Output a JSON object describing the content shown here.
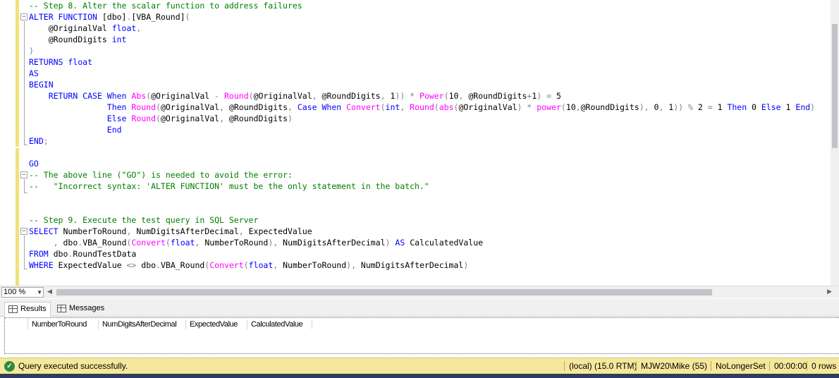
{
  "editor": {
    "lines": [
      [
        [
          "cm",
          "-- Step 8. Alter the scalar function to address failures"
        ]
      ],
      [
        [
          "kw",
          "ALTER FUNCTION "
        ],
        [
          "tx",
          "[dbo]"
        ],
        [
          "op",
          "."
        ],
        [
          "tx",
          "[VBA_Round]"
        ],
        [
          "op",
          "("
        ]
      ],
      [
        [
          "tx",
          "    @OriginalVal "
        ],
        [
          "kw",
          "float"
        ],
        [
          "op",
          ","
        ]
      ],
      [
        [
          "tx",
          "    @RoundDigits "
        ],
        [
          "kw",
          "int"
        ]
      ],
      [
        [
          "op",
          ")"
        ]
      ],
      [
        [
          "kw",
          "RETURNS float"
        ]
      ],
      [
        [
          "kw",
          "AS"
        ]
      ],
      [
        [
          "kw",
          "BEGIN"
        ]
      ],
      [
        [
          "tx",
          "    "
        ],
        [
          "kw",
          "RETURN CASE When "
        ],
        [
          "fn",
          "Abs"
        ],
        [
          "op",
          "("
        ],
        [
          "tx",
          "@OriginalVal "
        ],
        [
          "op",
          "- "
        ],
        [
          "fn",
          "Round"
        ],
        [
          "op",
          "("
        ],
        [
          "tx",
          "@OriginalVal"
        ],
        [
          "op",
          ", "
        ],
        [
          "tx",
          "@RoundDigits"
        ],
        [
          "op",
          ", "
        ],
        [
          "tx",
          "1"
        ],
        [
          "op",
          ")) * "
        ],
        [
          "fn",
          "Power"
        ],
        [
          "op",
          "("
        ],
        [
          "tx",
          "10"
        ],
        [
          "op",
          ", "
        ],
        [
          "tx",
          "@RoundDigits"
        ],
        [
          "op",
          "+"
        ],
        [
          "tx",
          "1"
        ],
        [
          "op",
          ") = "
        ],
        [
          "tx",
          "5"
        ]
      ],
      [
        [
          "tx",
          "                "
        ],
        [
          "kw",
          "Then "
        ],
        [
          "fn",
          "Round"
        ],
        [
          "op",
          "("
        ],
        [
          "tx",
          "@OriginalVal"
        ],
        [
          "op",
          ", "
        ],
        [
          "tx",
          "@RoundDigits"
        ],
        [
          "op",
          ", "
        ],
        [
          "kw",
          "Case When "
        ],
        [
          "fn",
          "Convert"
        ],
        [
          "op",
          "("
        ],
        [
          "kw",
          "int"
        ],
        [
          "op",
          ", "
        ],
        [
          "fn",
          "Round"
        ],
        [
          "op",
          "("
        ],
        [
          "fn",
          "abs"
        ],
        [
          "op",
          "("
        ],
        [
          "tx",
          "@OriginalVal"
        ],
        [
          "op",
          ") * "
        ],
        [
          "fn",
          "power"
        ],
        [
          "op",
          "("
        ],
        [
          "tx",
          "10"
        ],
        [
          "op",
          ","
        ],
        [
          "tx",
          "@RoundDigits"
        ],
        [
          "op",
          "), "
        ],
        [
          "tx",
          "0"
        ],
        [
          "op",
          ", "
        ],
        [
          "tx",
          "1"
        ],
        [
          "op",
          ")) % "
        ],
        [
          "tx",
          "2 "
        ],
        [
          "op",
          "= "
        ],
        [
          "tx",
          "1 "
        ],
        [
          "kw",
          "Then "
        ],
        [
          "tx",
          "0 "
        ],
        [
          "kw",
          "Else "
        ],
        [
          "tx",
          "1 "
        ],
        [
          "kw",
          "End"
        ],
        [
          "op",
          ")"
        ]
      ],
      [
        [
          "tx",
          "                "
        ],
        [
          "kw",
          "Else "
        ],
        [
          "fn",
          "Round"
        ],
        [
          "op",
          "("
        ],
        [
          "tx",
          "@OriginalVal"
        ],
        [
          "op",
          ", "
        ],
        [
          "tx",
          "@RoundDigits"
        ],
        [
          "op",
          ")"
        ]
      ],
      [
        [
          "tx",
          "                "
        ],
        [
          "kw",
          "End"
        ]
      ],
      [
        [
          "kw",
          "END"
        ],
        [
          "op",
          ";"
        ]
      ],
      [],
      [
        [
          "kw",
          "GO"
        ]
      ],
      [
        [
          "cm",
          "-- The above line (\"GO\") is needed to avoid the error:"
        ]
      ],
      [
        [
          "cm",
          "--   \"Incorrect syntax: 'ALTER FUNCTION' must be the only statement in the batch.\""
        ]
      ],
      [],
      [],
      [
        [
          "cm",
          "-- Step 9. Execute the test query in SQL Server"
        ]
      ],
      [
        [
          "kw",
          "SELECT "
        ],
        [
          "tx",
          "NumberToRound"
        ],
        [
          "op",
          ", "
        ],
        [
          "tx",
          "NumDigitsAfterDecimal"
        ],
        [
          "op",
          ", "
        ],
        [
          "tx",
          "ExpectedValue"
        ]
      ],
      [
        [
          "tx",
          "     "
        ],
        [
          "op",
          ", "
        ],
        [
          "tx",
          "dbo"
        ],
        [
          "op",
          "."
        ],
        [
          "tx",
          "VBA_Round"
        ],
        [
          "op",
          "("
        ],
        [
          "fn",
          "Convert"
        ],
        [
          "op",
          "("
        ],
        [
          "kw",
          "float"
        ],
        [
          "op",
          ", "
        ],
        [
          "tx",
          "NumberToRound"
        ],
        [
          "op",
          "), "
        ],
        [
          "tx",
          "NumDigitsAfterDecimal"
        ],
        [
          "op",
          ") "
        ],
        [
          "kw",
          "AS "
        ],
        [
          "tx",
          "CalculatedValue"
        ]
      ],
      [
        [
          "kw",
          "FROM "
        ],
        [
          "tx",
          "dbo"
        ],
        [
          "op",
          "."
        ],
        [
          "tx",
          "RoundTestData"
        ]
      ],
      [
        [
          "kw",
          "WHERE "
        ],
        [
          "tx",
          "ExpectedValue "
        ],
        [
          "op",
          "<> "
        ],
        [
          "tx",
          "dbo"
        ],
        [
          "op",
          "."
        ],
        [
          "tx",
          "VBA_Round"
        ],
        [
          "op",
          "("
        ],
        [
          "fn",
          "Convert"
        ],
        [
          "op",
          "("
        ],
        [
          "kw",
          "float"
        ],
        [
          "op",
          ", "
        ],
        [
          "tx",
          "NumberToRound"
        ],
        [
          "op",
          "), "
        ],
        [
          "tx",
          "NumDigitsAfterDecimal"
        ],
        [
          "op",
          ")"
        ]
      ]
    ]
  },
  "zoom": {
    "value": "100 %"
  },
  "tabs": {
    "results": "Results",
    "messages": "Messages"
  },
  "grid": {
    "columns": [
      "NumberToRound",
      "NumDigitsAfterDecimal",
      "ExpectedValue",
      "CalculatedValue"
    ]
  },
  "status": {
    "message": "Query executed successfully.",
    "server": "(local) (15.0 RTM)",
    "user": "MJW20\\Mike (55)",
    "database": "NoLongerSet",
    "elapsed": "00:00:00",
    "rows": "0 rows"
  },
  "colors": {
    "keyword": "#0000ff",
    "function": "#ff00ff",
    "comment": "#008000",
    "operator": "#808080",
    "status_bar": "#f5e79c"
  },
  "icons": {
    "status": "check-circle-icon",
    "results_tab": "grid-icon",
    "messages_tab": "messages-icon"
  }
}
